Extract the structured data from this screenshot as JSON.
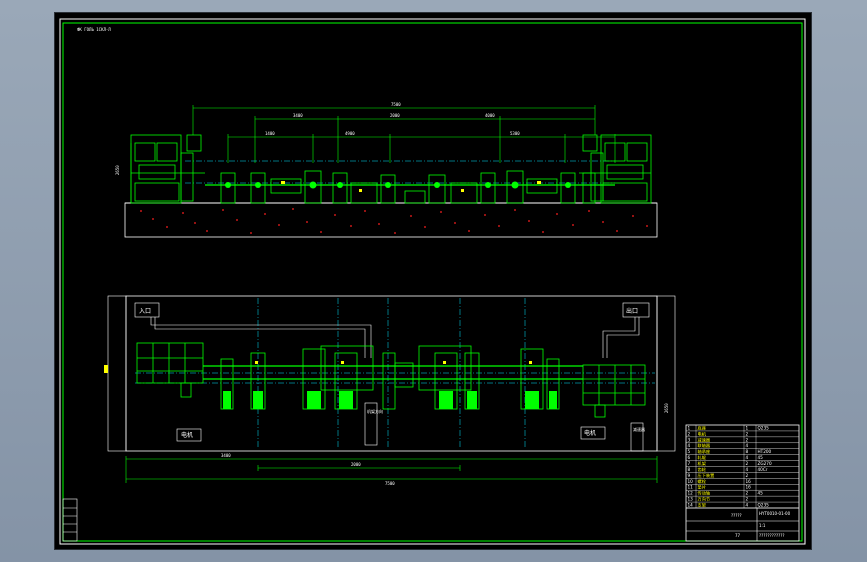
{
  "drawing": {
    "header_text": "ФК ГОЛЬ 1СКЛ-Л",
    "drawing_number": "HYT0010-01-00",
    "title_block_name": "?????",
    "sheet_code": "1:1",
    "scale_code": "1:1",
    "sheet_mark": "77",
    "school": "????????????",
    "drawing_area_title": "??",
    "total_length_top": "7500",
    "total_length_bottom": "7500",
    "dims_top_row2": [
      "3400",
      "2000",
      "4000"
    ],
    "dims_top_row3": [
      "1400",
      "4900",
      "5300"
    ],
    "dims_bottom_row1": [
      "3400"
    ],
    "dims_bottom_row2": [
      "2000"
    ],
    "height_dim": "2650",
    "plan_width_dim": "2650",
    "labels": {
      "label_left_box": "入口",
      "label_right_box": "出口",
      "motor_left": "电机",
      "motor_right": "电机",
      "center_box": "机架方向",
      "right_small_box": "减速器"
    },
    "parts_list": [
      [
        "1",
        "底座",
        "1",
        "Q235"
      ],
      [
        "2",
        "电机",
        "2",
        ""
      ],
      [
        "3",
        "减速器",
        "2",
        ""
      ],
      [
        "4",
        "联轴器",
        "4",
        ""
      ],
      [
        "5",
        "轴承座",
        "8",
        "HT200"
      ],
      [
        "6",
        "轧辊",
        "4",
        "45"
      ],
      [
        "7",
        "机架",
        "2",
        "ZG270"
      ],
      [
        "8",
        "齿轮",
        "4",
        "40Cr"
      ],
      [
        "9",
        "压下装置",
        "2",
        ""
      ],
      [
        "10",
        "螺栓",
        "16",
        ""
      ],
      [
        "11",
        "垫片",
        "16",
        ""
      ],
      [
        "12",
        "传动轴",
        "2",
        "45"
      ],
      [
        "13",
        "万向节",
        "2",
        ""
      ],
      [
        "14",
        "支架",
        "4",
        "Q235"
      ]
    ]
  }
}
